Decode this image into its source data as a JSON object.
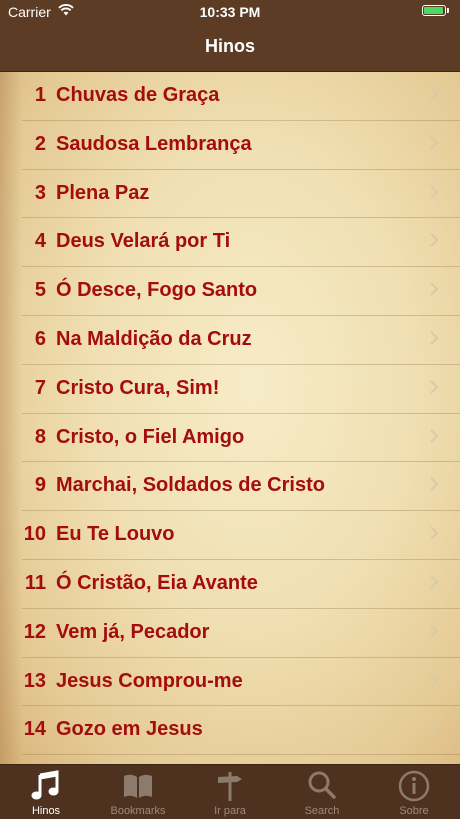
{
  "status": {
    "carrier": "Carrier",
    "time": "10:33 PM",
    "battery_color": "#4cd964"
  },
  "nav": {
    "title": "Hinos"
  },
  "hymns": [
    {
      "number": "1",
      "title": "Chuvas de Graça"
    },
    {
      "number": "2",
      "title": "Saudosa Lembrança"
    },
    {
      "number": "3",
      "title": "Plena Paz"
    },
    {
      "number": "4",
      "title": "Deus Velará por Ti"
    },
    {
      "number": "5",
      "title": "Ó Desce, Fogo Santo"
    },
    {
      "number": "6",
      "title": "Na Maldição da Cruz"
    },
    {
      "number": "7",
      "title": "Cristo Cura, Sim!"
    },
    {
      "number": "8",
      "title": "Cristo, o Fiel Amigo"
    },
    {
      "number": "9",
      "title": "Marchai, Soldados de Cristo"
    },
    {
      "number": "10",
      "title": "Eu Te Louvo"
    },
    {
      "number": "11",
      "title": "Ó Cristão, Eia Avante"
    },
    {
      "number": "12",
      "title": "Vem já, Pecador"
    },
    {
      "number": "13",
      "title": "Jesus Comprou-me"
    },
    {
      "number": "14",
      "title": "Gozo em Jesus"
    }
  ],
  "colors": {
    "accent_text": "#a40d0d",
    "bar_background": "#5d3c25",
    "tab_active": "#ffffff",
    "tab_inactive": "#9c8a7c"
  },
  "tabs": [
    {
      "label": "Hinos",
      "icon": "music-note-icon",
      "active": true
    },
    {
      "label": "Bookmarks",
      "icon": "book-icon",
      "active": false
    },
    {
      "label": "Ir para",
      "icon": "signpost-icon",
      "active": false
    },
    {
      "label": "Search",
      "icon": "search-icon",
      "active": false
    },
    {
      "label": "Sobre",
      "icon": "info-icon",
      "active": false
    }
  ]
}
